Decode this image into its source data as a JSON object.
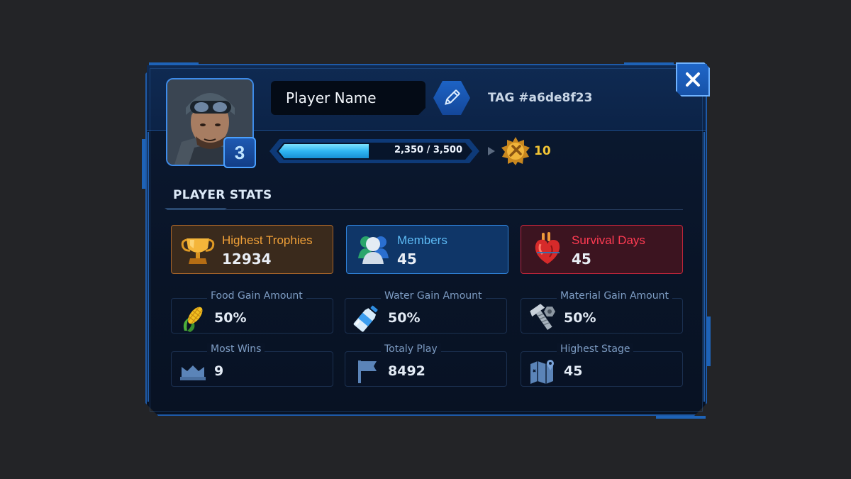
{
  "header": {
    "player_name": "Player Name",
    "tag": "TAG #a6de8f23",
    "level": "3"
  },
  "progress": {
    "current": 2350,
    "max": 3500,
    "text": "2,350 / 3,500",
    "reward_count": "10"
  },
  "section": {
    "title": "PLAYER STATS"
  },
  "highlights": [
    {
      "label": "Highest Trophies",
      "value": "12934",
      "icon": "trophy-icon",
      "color": "#f0a038"
    },
    {
      "label": "Members",
      "value": "45",
      "icon": "members-icon",
      "color": "#5dbbf5"
    },
    {
      "label": "Survival Days",
      "value": "45",
      "icon": "heart-icon",
      "color": "#ff3b52"
    }
  ],
  "stats": [
    {
      "label": "Food Gain Amount",
      "value": "50%",
      "icon": "corn-icon"
    },
    {
      "label": "Water Gain Amount",
      "value": "50%",
      "icon": "water-bottle-icon"
    },
    {
      "label": "Material Gain Amount",
      "value": "50%",
      "icon": "bolt-nut-icon"
    },
    {
      "label": "Most Wins",
      "value": "9",
      "icon": "wins-crown-icon"
    },
    {
      "label": "Totaly Play",
      "value": "8492",
      "icon": "flag-icon"
    },
    {
      "label": "Highest Stage",
      "value": "45",
      "icon": "map-icon"
    }
  ]
}
